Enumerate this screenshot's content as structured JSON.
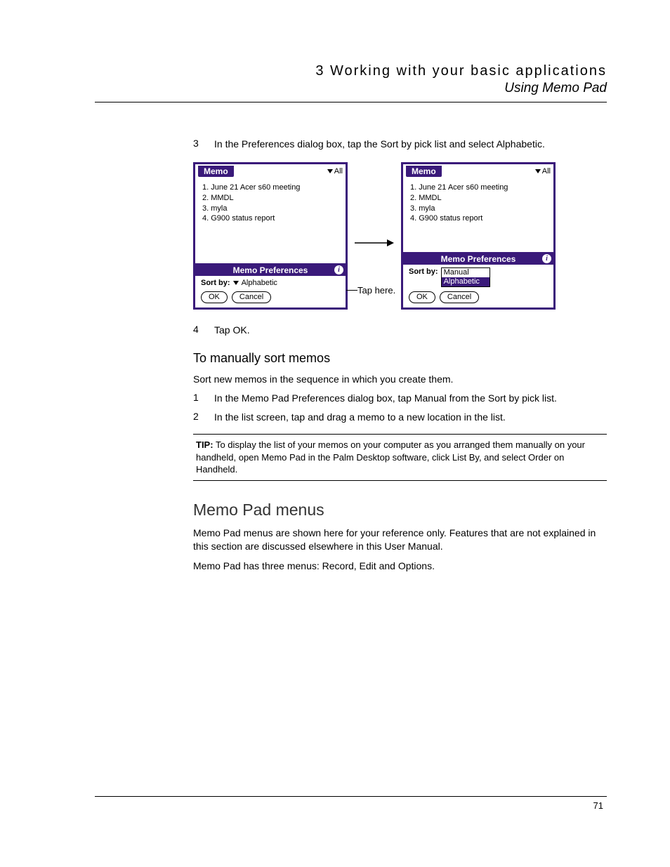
{
  "header": {
    "chapter": "3 Working with your basic applications",
    "section": "Using Memo Pad"
  },
  "steps_a": [
    {
      "n": "3",
      "t": "In the Preferences dialog box, tap the Sort by pick list and select Alphabetic."
    }
  ],
  "palm": {
    "tab": "Memo",
    "filter": "All",
    "items": [
      "1.  June 21 Acer s60 meeting",
      "2.  MMDL",
      "3.  myla",
      "4.  G900 status report"
    ],
    "prefs_title": "Memo Preferences",
    "sortby_label": "Sort by:",
    "left_value": "Alphabetic",
    "right_options": [
      "Manual",
      "Alphabetic"
    ],
    "ok": "OK",
    "cancel": "Cancel"
  },
  "annotation": "Tap here.",
  "steps_b": [
    {
      "n": "4",
      "t": "Tap OK."
    }
  ],
  "subhead": "To manually sort memos",
  "sub_intro": "Sort new memos in the sequence in which you create them.",
  "steps_c": [
    {
      "n": "1",
      "t": "In the Memo Pad Preferences dialog box, tap Manual from the Sort by pick list."
    },
    {
      "n": "2",
      "t": "In the list screen, tap and drag a memo to a new location in the list."
    }
  ],
  "tip": {
    "label": "TIP:",
    "text": "To display the list of your memos on your computer as you arranged them manually on your handheld, open Memo Pad in the Palm Desktop software, click List By, and select Order on Handheld."
  },
  "section2": {
    "title": "Memo Pad menus",
    "p1": "Memo Pad menus are shown here for your reference only. Features that are not explained in this section are discussed elsewhere in this User Manual.",
    "p2": "Memo Pad has three menus: Record, Edit and Options."
  },
  "page_number": "71"
}
